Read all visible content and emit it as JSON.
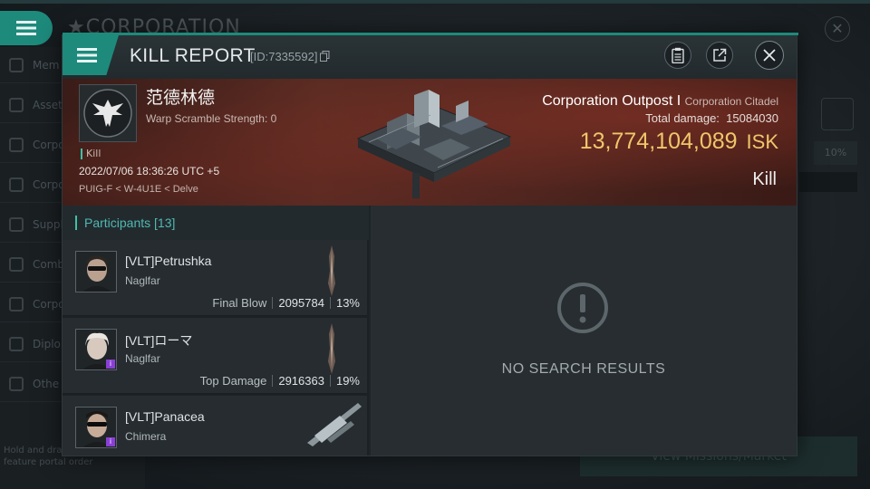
{
  "background": {
    "title": "CORPORATION",
    "sidebar": [
      {
        "label": "Mem"
      },
      {
        "label": "Asset"
      },
      {
        "label": "Corpo"
      },
      {
        "label": "Corpo"
      },
      {
        "label": "Suppl"
      },
      {
        "label": "Comb"
      },
      {
        "label": "Corpo"
      },
      {
        "label": "Diplor"
      },
      {
        "label": "Othe"
      }
    ],
    "footnote": "Hold and drag\nfeature portal order",
    "percent": "10%",
    "bottom_button": "View Missions/Market"
  },
  "modal": {
    "title": "KILL REPORT",
    "report_id": "[ID:7335592]",
    "icons": [
      "clipboard-icon",
      "share-icon",
      "close-icon"
    ]
  },
  "victim": {
    "name": "范德林德",
    "subtitle": "Warp Scramble Strength: 0",
    "kill_tag": "Kill",
    "datetime": "2022/07/06 18:36:26 UTC +5",
    "location": "PUIG-F < W-4U1E < Delve"
  },
  "target": {
    "name": "Corporation Outpost I",
    "type": "Corporation Citadel",
    "damage_label": "Total damage:",
    "damage_value": "15084030",
    "isk_value": "13,774,104,089",
    "isk_unit": "ISK",
    "result": "Kill"
  },
  "participants": {
    "header": "Participants [13]",
    "rows": [
      {
        "name": "[VLT]Petrushka",
        "ship": "Naglfar",
        "role": "Final Blow",
        "damage": "2095784",
        "percent": "13%",
        "badge": false,
        "ship_icon": "dreadnought-icon"
      },
      {
        "name": "[VLT]ローマ",
        "ship": "Naglfar",
        "role": "Top Damage",
        "damage": "2916363",
        "percent": "19%",
        "badge": true,
        "ship_icon": "dreadnought-icon"
      },
      {
        "name": "[VLT]Panacea",
        "ship": "Chimera",
        "role": "",
        "damage": "",
        "percent": "",
        "badge": true,
        "ship_icon": "carrier-icon"
      }
    ]
  },
  "results": {
    "empty_text": "NO SEARCH RESULTS"
  },
  "colors": {
    "accent": "#1d8a7c",
    "isk": "#f0c66a",
    "participants_header": "#4fb9b2",
    "badge": "#8a3fd6"
  }
}
